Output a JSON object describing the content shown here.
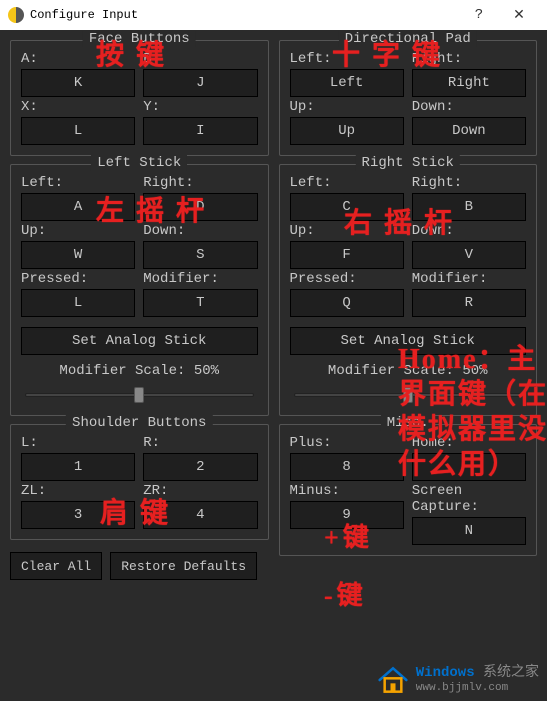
{
  "window": {
    "title": "Configure Input",
    "help": "?",
    "close": "✕"
  },
  "face": {
    "title": "Face Buttons",
    "a_lbl": "A:",
    "a_val": "K",
    "b_lbl": "B:",
    "b_val": "J",
    "x_lbl": "X:",
    "x_val": "L",
    "y_lbl": "Y:",
    "y_val": "I"
  },
  "dpad": {
    "title": "Directional Pad",
    "left_lbl": "Left:",
    "left_val": "Left",
    "right_lbl": "Right:",
    "right_val": "Right",
    "up_lbl": "Up:",
    "up_val": "Up",
    "down_lbl": "Down:",
    "down_val": "Down"
  },
  "lstick": {
    "title": "Left Stick",
    "left_lbl": "Left:",
    "left_val": "A",
    "right_lbl": "Right:",
    "right_val": "D",
    "up_lbl": "Up:",
    "up_val": "W",
    "down_lbl": "Down:",
    "down_val": "S",
    "pressed_lbl": "Pressed:",
    "pressed_val": "L",
    "mod_lbl": "Modifier:",
    "mod_val": "T",
    "set_analog": "Set Analog Stick",
    "scale_label": "Modifier Scale: 50%",
    "scale_pct": 50
  },
  "rstick": {
    "title": "Right Stick",
    "left_lbl": "Left:",
    "left_val": "C",
    "right_lbl": "Right:",
    "right_val": "B",
    "up_lbl": "Up:",
    "up_val": "F",
    "down_lbl": "Down:",
    "down_val": "V",
    "pressed_lbl": "Pressed:",
    "pressed_val": "Q",
    "mod_lbl": "Modifier:",
    "mod_val": "R",
    "set_analog": "Set Analog Stick",
    "scale_label": "Modifier Scale: 50%",
    "scale_pct": 50
  },
  "shoulder": {
    "title": "Shoulder Buttons",
    "l_lbl": "L:",
    "l_val": "1",
    "r_lbl": "R:",
    "r_val": "2",
    "zl_lbl": "ZL:",
    "zl_val": "3",
    "zr_lbl": "ZR:",
    "zr_val": "4"
  },
  "misc": {
    "title": "Misc.",
    "plus_lbl": "Plus:",
    "plus_val": "8",
    "home_lbl": "Home:",
    "home_val": "",
    "minus_lbl": "Minus:",
    "minus_val": "9",
    "sc_lbl": "Screen Capture:",
    "sc_val": "N"
  },
  "buttons": {
    "clear_all": "Clear All",
    "restore_defaults": "Restore Defaults"
  },
  "annotations": {
    "face": "按键",
    "dpad": "十字键",
    "lstick": "左摇杆",
    "rstick": "右摇杆",
    "shoulder": "肩键",
    "plus": "+键",
    "minus": "-键",
    "home": "Home：主界面键（在模拟器里没什么用）"
  },
  "watermark": {
    "brand": "Windows",
    "suffix": "系统之家",
    "url": "www.bjjmlv.com"
  }
}
